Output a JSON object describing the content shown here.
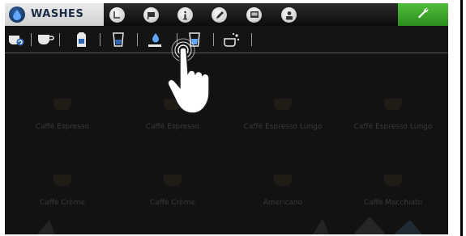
{
  "topbar": {
    "mode_label": "WASHES",
    "mode_icon": "water-drop-icon",
    "buttons": [
      {
        "name": "timer-icon"
      },
      {
        "name": "flag-icon"
      },
      {
        "name": "info-icon"
      },
      {
        "name": "pencil-icon"
      },
      {
        "name": "display-icon"
      },
      {
        "name": "user-icon"
      }
    ],
    "settings_icon": "wrench-icon",
    "colors": {
      "mode_bg": "#e0e0e0",
      "settings_bg": "#3aa82a",
      "accent": "#1f4f8f"
    }
  },
  "toolrow": {
    "icons": [
      "cup-refresh-icon",
      "cup-icon",
      "milk-carton-icon",
      "glass-icon",
      "hand-drop-icon",
      "glass-blue-icon",
      "cleaning-hand-icon"
    ]
  },
  "grid": {
    "row1": [
      "Caffè Espresso",
      "Caffè Espresso",
      "Caffè Espresso Lungo",
      "Caffè Espresso Lungo"
    ],
    "row2": [
      "Caffè Crème",
      "Caffè Crème",
      "Americano",
      "Caffè Macchiato"
    ]
  }
}
